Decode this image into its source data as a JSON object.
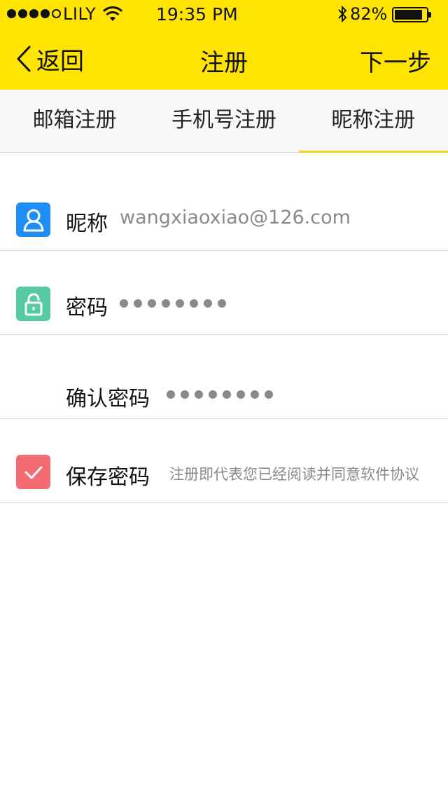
{
  "status_bar": {
    "carrier": "LILY",
    "time": "19:35  PM",
    "battery_percent": "82%",
    "signal_filled": 4,
    "signal_total": 5
  },
  "nav": {
    "back_label": "返回",
    "title": "注册",
    "next_label": "下一步",
    "background_color": "#ffe400"
  },
  "tabs": [
    {
      "label": "邮箱注册",
      "active": false
    },
    {
      "label": "手机号注册",
      "active": false
    },
    {
      "label": "昵称注册",
      "active": true
    }
  ],
  "form": {
    "nickname": {
      "label": "昵称",
      "value": "wangxiaoxiao@126.com",
      "icon": "user-icon",
      "icon_color": "#1e8ef7"
    },
    "password": {
      "label": "密码",
      "masked_length": 8,
      "icon": "lock-icon",
      "icon_color": "#56c9a5"
    },
    "confirm_password": {
      "label": "确认密码",
      "masked_length": 8
    },
    "save_password": {
      "label": "保存密码",
      "checked": true,
      "icon": "checkbox-check-icon",
      "icon_color": "#f56b74"
    },
    "terms_text": "注册即代表您已经阅读并同意软件协议"
  }
}
